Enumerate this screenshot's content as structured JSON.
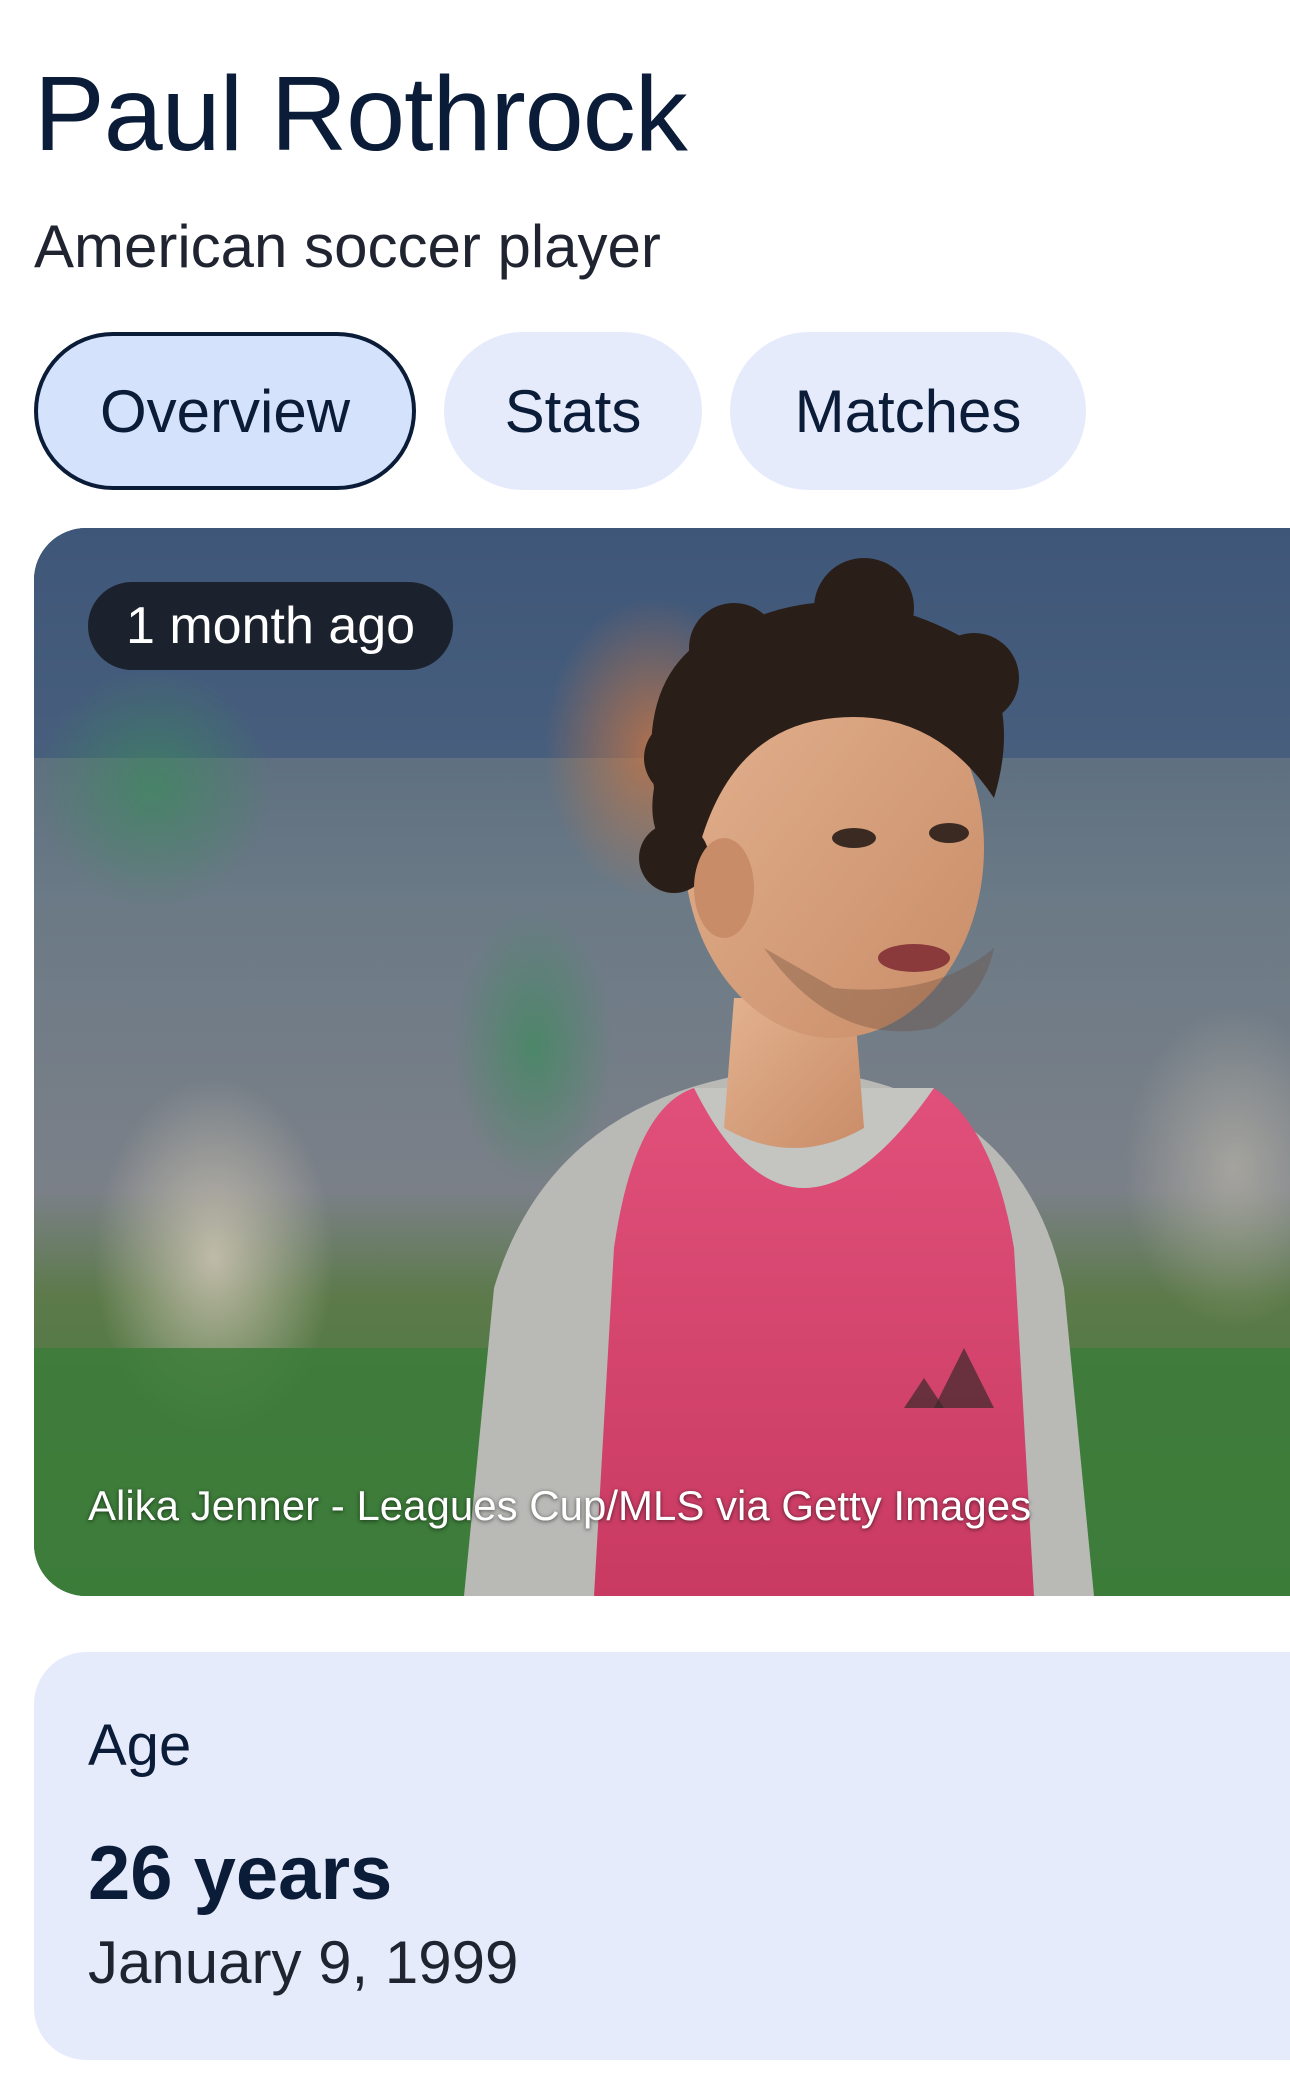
{
  "header": {
    "title": "Paul Rothrock",
    "subtitle": "American soccer player"
  },
  "tabs": [
    {
      "label": "Overview",
      "selected": true
    },
    {
      "label": "Stats",
      "selected": false
    },
    {
      "label": "Matches",
      "selected": false
    }
  ],
  "photo": {
    "timestamp": "1 month ago",
    "credit": "Alika Jenner - Leagues Cup/MLS via Getty Images",
    "alt": "Player portrait"
  },
  "age_card": {
    "label": "Age",
    "value": "26 years",
    "birth_date": "January 9, 1999"
  },
  "colors": {
    "text_primary": "#0b1c38",
    "chip_background": "#e6ebfc",
    "chip_selected_background": "#d4e2fc",
    "card_background": "#e6ebfc"
  }
}
